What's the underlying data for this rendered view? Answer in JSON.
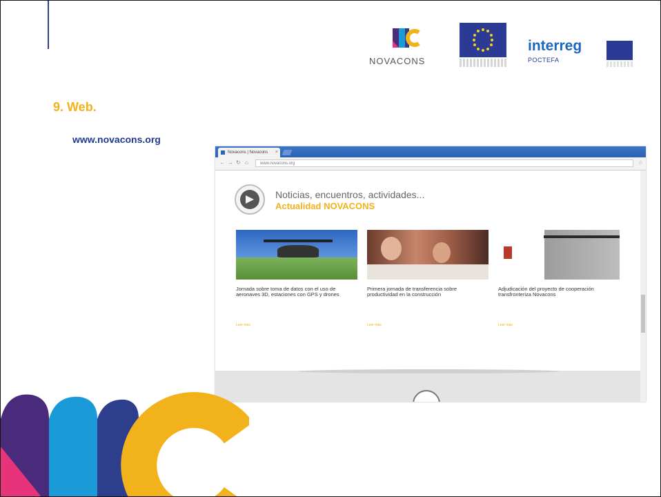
{
  "slide": {
    "section_title": "9. Web.",
    "url_text": "www.novacons.org"
  },
  "logos": {
    "novacons": {
      "mark": "NC",
      "wordmark": "NOVACONS"
    },
    "eu_flag_icon": "eu-flag-icon",
    "interreg": {
      "name": "interreg",
      "program": "POCTEFA"
    }
  },
  "browser": {
    "tab_title": "Novacons | Novacons",
    "address": "www.novacons.org"
  },
  "website": {
    "news_heading": "Noticias, encuentros, actividades...",
    "news_subheading": "Actualidad NOVACONS",
    "cards": [
      {
        "title": "Jornada sobre toma de datos con el uso de aeronaves 3D, estaciones con GPS y drones",
        "more": "Leer más"
      },
      {
        "title": "Primera jornada de transferencia sobre productividad en la construcción",
        "more": "Leer más"
      },
      {
        "title": "Adjudicación del proyecto de cooperación transfronteriza Novacons",
        "more": "Leer más"
      }
    ]
  },
  "colors": {
    "accent_yellow": "#f2b21b",
    "link_blue": "#1f3a93",
    "nc_purple": "#4a2a7a",
    "nc_blue": "#1a9ad6",
    "nc_pink": "#e7337a",
    "nc_navy": "#2d3e8c"
  }
}
